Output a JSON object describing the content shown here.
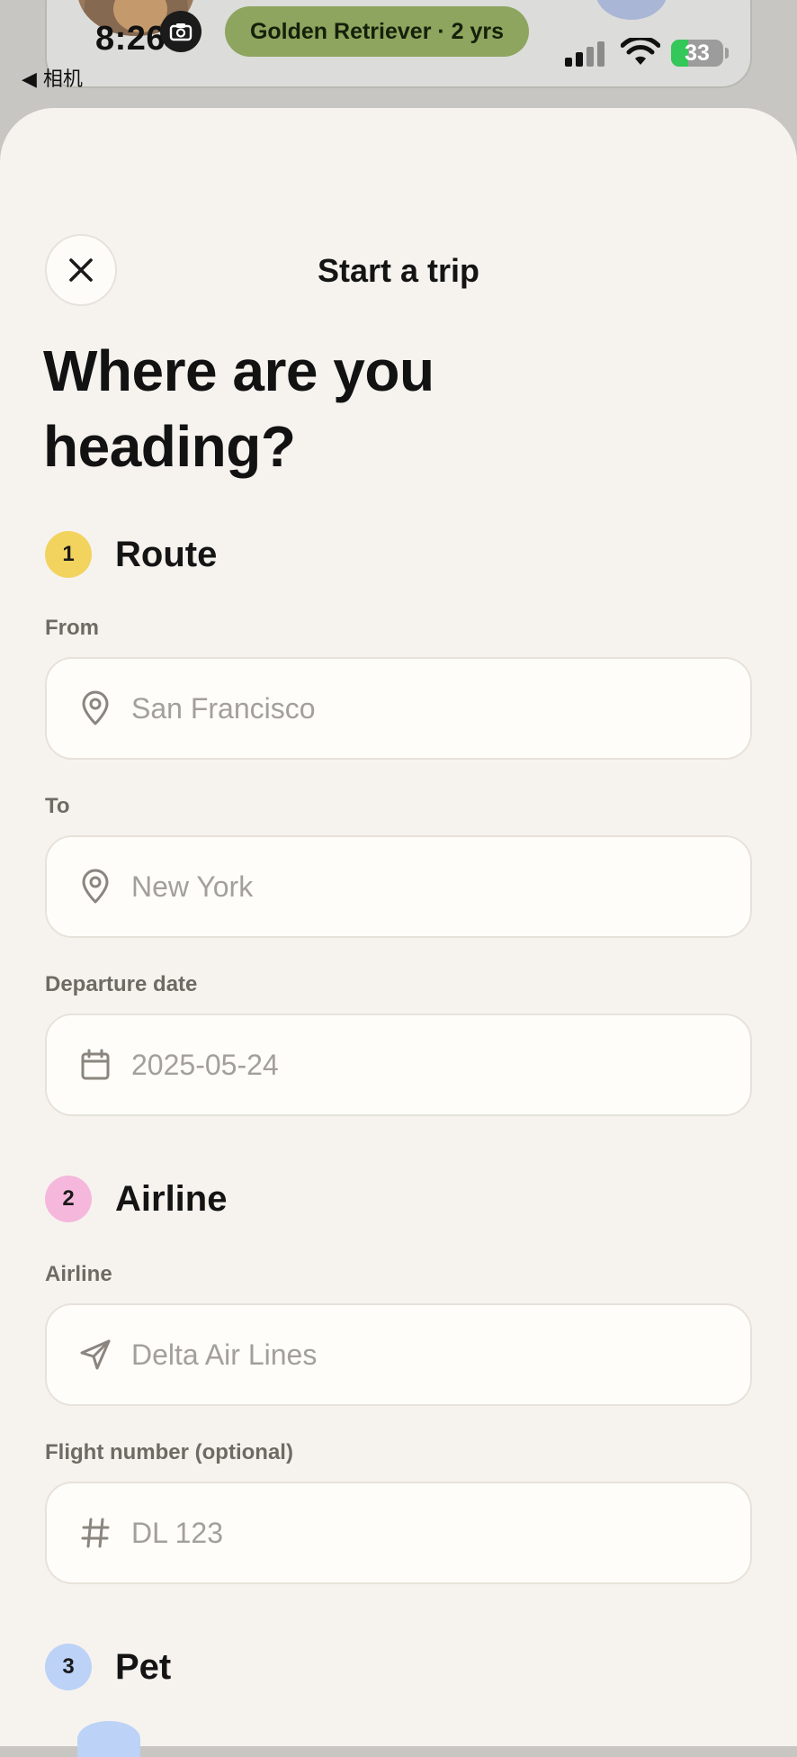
{
  "status_bar": {
    "time": "8:26",
    "back_label": "◀ 相机",
    "battery_percent": "33",
    "battery_level": 0.33
  },
  "background_app": {
    "breed_pill": "Golden Retriever · 2 yrs"
  },
  "sheet": {
    "title": "Start a trip",
    "headline_line1": "Where are you",
    "headline_line2": "heading?",
    "close_icon": "close-icon"
  },
  "sections": {
    "route": {
      "step": "1",
      "title": "Route",
      "badge_color": "#f2d35e",
      "from_label": "From",
      "from_value": "San Francisco",
      "to_label": "To",
      "to_value": "New York",
      "date_label": "Departure date",
      "date_value": "2025-05-24"
    },
    "airline": {
      "step": "2",
      "title": "Airline",
      "badge_color": "#f5b8dc",
      "airline_label": "Airline",
      "airline_value": "Delta Air Lines",
      "flight_label": "Flight number (optional)",
      "flight_value": "DL 123"
    },
    "pet": {
      "step": "3",
      "title": "Pet",
      "badge_color": "#bcd2f6"
    }
  },
  "icons": {
    "location": "map-pin-icon",
    "calendar": "calendar-icon",
    "airline": "send-arrow-icon",
    "flight": "hash-icon"
  }
}
